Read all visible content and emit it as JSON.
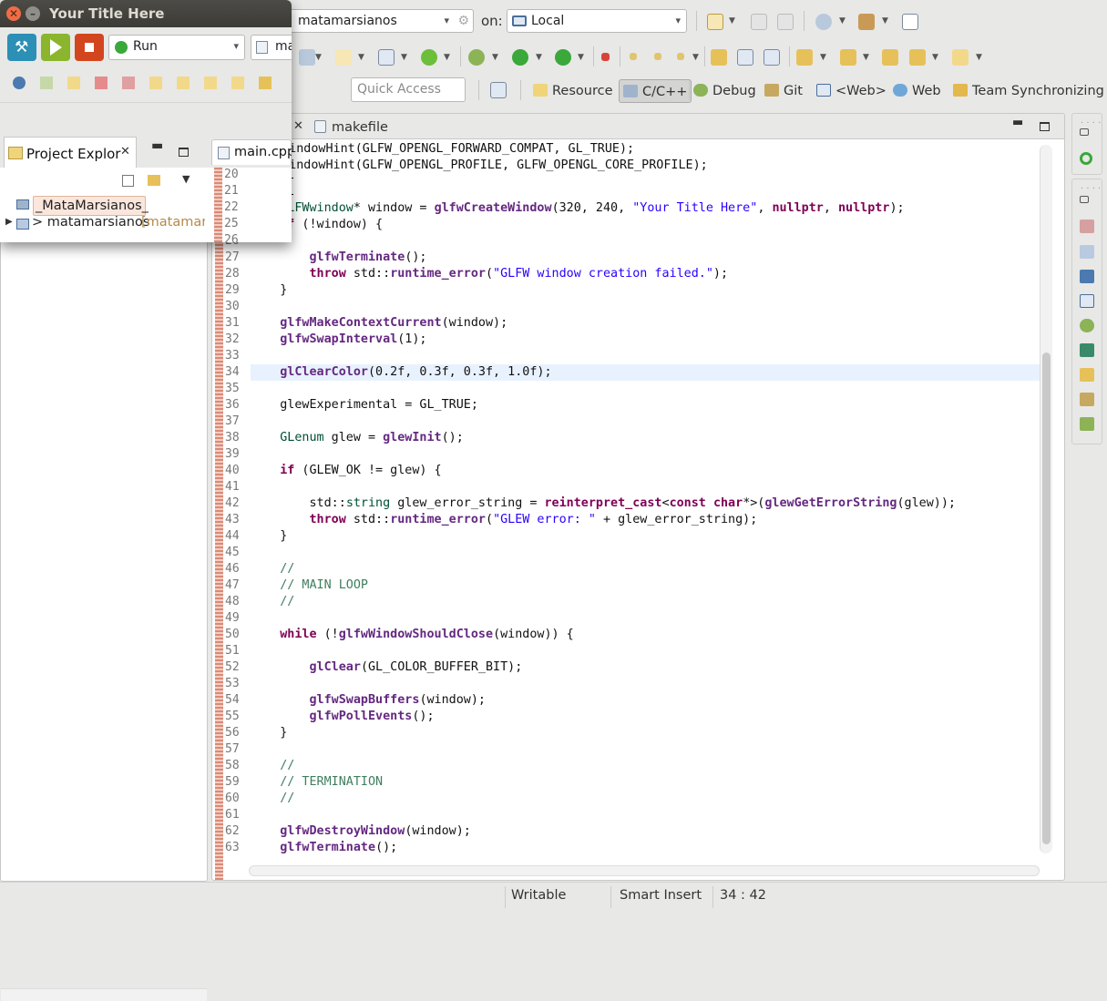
{
  "toolbar": {
    "launch_config": "matamarsianos",
    "on_label": "on:",
    "target": "Local",
    "quick_access_placeholder": "Quick Access"
  },
  "perspectives": [
    {
      "label": "Resource",
      "icon": "resource-perspective-icon"
    },
    {
      "label": "C/C++",
      "icon": "cpp-perspective-icon",
      "active": true
    },
    {
      "label": "Debug",
      "icon": "bug-icon"
    },
    {
      "label": "Git",
      "icon": "git-icon"
    },
    {
      "label": "<Web>",
      "icon": "web-grid-icon"
    },
    {
      "label": "Web",
      "icon": "globe-icon"
    },
    {
      "label": "Team Synchronizing",
      "icon": "team-sync-icon"
    }
  ],
  "editor": {
    "tabs": [
      {
        "label": "main.cpp",
        "active": true
      },
      {
        "label": "makefile"
      }
    ],
    "first_lines": [
      "fwWindowHint(GLFW_OPENGL_FORWARD_COMPAT, GL_TRUE);",
      "fwWindowHint(GLFW_OPENGL_PROFILE, GLFW_OPENGL_CORE_PROFILE);"
    ],
    "lines": [
      {
        "n": "20",
        "t": "    gl"
      },
      {
        "n": "21",
        "t": "    gl"
      },
      {
        "n": "22",
        "t": "    GLFWwindow* window = glfwCreateWindow(320, 240, \"Your Title Here\", nullptr, nullptr);"
      },
      {
        "n": "25",
        "t": "    if (!window) {"
      },
      {
        "n": "26",
        "t": ""
      },
      {
        "n": "27",
        "t": "        glfwTerminate();"
      },
      {
        "n": "28",
        "t": "        throw std::runtime_error(\"GLFW window creation failed.\");"
      },
      {
        "n": "29",
        "t": "    }"
      },
      {
        "n": "30",
        "t": ""
      },
      {
        "n": "31",
        "t": "    glfwMakeContextCurrent(window);"
      },
      {
        "n": "32",
        "t": "    glfwSwapInterval(1);"
      },
      {
        "n": "33",
        "t": ""
      },
      {
        "n": "34",
        "t": "    glClearColor(0.2f, 0.3f, 0.3f, 1.0f);"
      },
      {
        "n": "35",
        "t": ""
      },
      {
        "n": "36",
        "t": "    glewExperimental = GL_TRUE;"
      },
      {
        "n": "37",
        "t": ""
      },
      {
        "n": "38",
        "t": "    GLenum glew = glewInit();"
      },
      {
        "n": "39",
        "t": ""
      },
      {
        "n": "40",
        "t": "    if (GLEW_OK != glew) {"
      },
      {
        "n": "41",
        "t": ""
      },
      {
        "n": "42",
        "t": "        std::string glew_error_string = reinterpret_cast<const char*>(glewGetErrorString(glew));"
      },
      {
        "n": "43",
        "t": "        throw std::runtime_error(\"GLEW error: \" + glew_error_string);"
      },
      {
        "n": "44",
        "t": "    }"
      },
      {
        "n": "45",
        "t": ""
      },
      {
        "n": "46",
        "t": "    //"
      },
      {
        "n": "47",
        "t": "    // MAIN LOOP"
      },
      {
        "n": "48",
        "t": "    //"
      },
      {
        "n": "49",
        "t": ""
      },
      {
        "n": "50",
        "t": "    while (!glfwWindowShouldClose(window)) {"
      },
      {
        "n": "51",
        "t": ""
      },
      {
        "n": "52",
        "t": "        glClear(GL_COLOR_BUFFER_BIT);"
      },
      {
        "n": "53",
        "t": ""
      },
      {
        "n": "54",
        "t": "        glfwSwapBuffers(window);"
      },
      {
        "n": "55",
        "t": "        glfwPollEvents();"
      },
      {
        "n": "56",
        "t": "    }"
      },
      {
        "n": "57",
        "t": ""
      },
      {
        "n": "58",
        "t": "    //"
      },
      {
        "n": "59",
        "t": "    // TERMINATION"
      },
      {
        "n": "60",
        "t": "    //"
      },
      {
        "n": "61",
        "t": ""
      },
      {
        "n": "62",
        "t": "    glfwDestroyWindow(window);"
      },
      {
        "n": "63",
        "t": "    glfwTerminate();"
      }
    ],
    "highlight_line": "34"
  },
  "status": {
    "writable": "Writable",
    "insert_mode": "Smart Insert",
    "position": "34 : 42"
  },
  "project_explorer": {
    "title": "Project Explor",
    "items": [
      {
        "label": "_MataMarsianos_"
      },
      {
        "label": "> matamarsianos",
        "suffix": "[matamars"
      }
    ]
  },
  "glfw_window": {
    "title": "Your Title Here",
    "run_combo": "Run",
    "partial_combo": "ma"
  },
  "colors": {
    "keyword": "#7f0055",
    "function": "#642880",
    "string": "#2a00ff",
    "comment": "#3f7f5f",
    "highlight": "#e8f2fe",
    "title_bar": "#3c3b37"
  }
}
